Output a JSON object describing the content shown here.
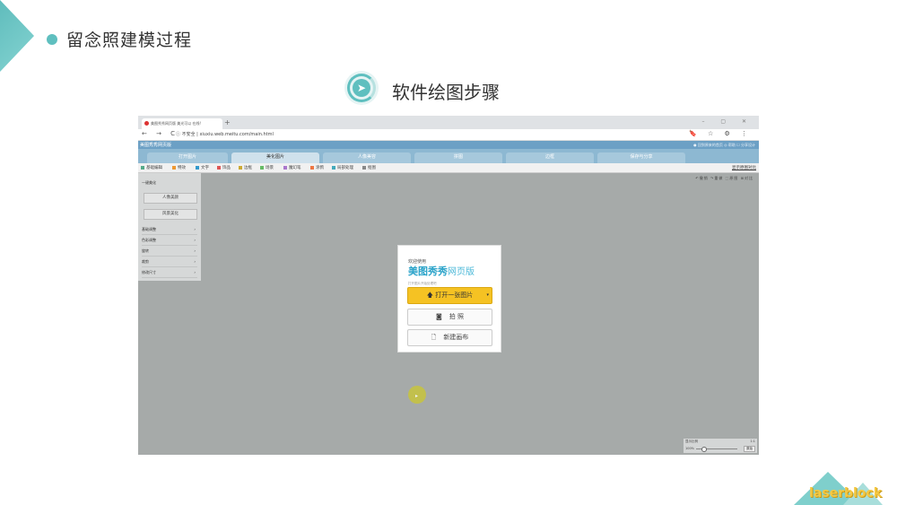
{
  "slide": {
    "title": "留念照建模过程",
    "step_title": "软件绘图步骤",
    "brand": "laserblock",
    "colors": {
      "accent": "#5fbfbf",
      "brand_text": "#f5c842"
    }
  },
  "browser": {
    "tab_title": "美图秀秀网页版 美光可以 在线!",
    "new_tab": "+",
    "window_controls": "–  ▢  ✕",
    "nav": "← → C",
    "url": "ⓘ 不安全 | xiuxiu.web.meitu.com/main.html",
    "right_icons": "🔖 ☆ ⚙ ⋮"
  },
  "app": {
    "logo_text": "美图秀秀网页版",
    "header_right": "● 回到原来的首页   ◎ 帮助   ☐ 分享设计",
    "menu_tabs": [
      "打开图片",
      "美化图片",
      "人像美容",
      "拼图",
      "边框",
      "保存与分享"
    ],
    "active_tab": 1,
    "tools": [
      "基础编辑",
      "特效",
      "文字",
      "饰品",
      "边框",
      "场景",
      "魔幻笔",
      "涂鸦",
      "局部处理",
      "抠图"
    ],
    "toolbar_right": "显示原图对比",
    "right_tools": "↶撤销 ↷重做 ⬚原图 ⊞对比",
    "sidebar": {
      "head": "一键美化",
      "buttons": [
        "人像美颜",
        "风景美化"
      ],
      "items": [
        "基础调整",
        "色彩调整",
        "旋转",
        "裁剪",
        "修改尺寸"
      ]
    },
    "dialog": {
      "welcome": "欢迎使用",
      "logo_main": "美图秀秀",
      "logo_sub": "网页版",
      "hint": "打开图片开始处理吧",
      "open_label": "打开一张图片",
      "camera_label": "拍  照",
      "new_canvas_label": "新建画布"
    },
    "zoom": {
      "label": "显示比例",
      "ratio": "1:1",
      "value": "100%",
      "fit": "原始"
    }
  }
}
